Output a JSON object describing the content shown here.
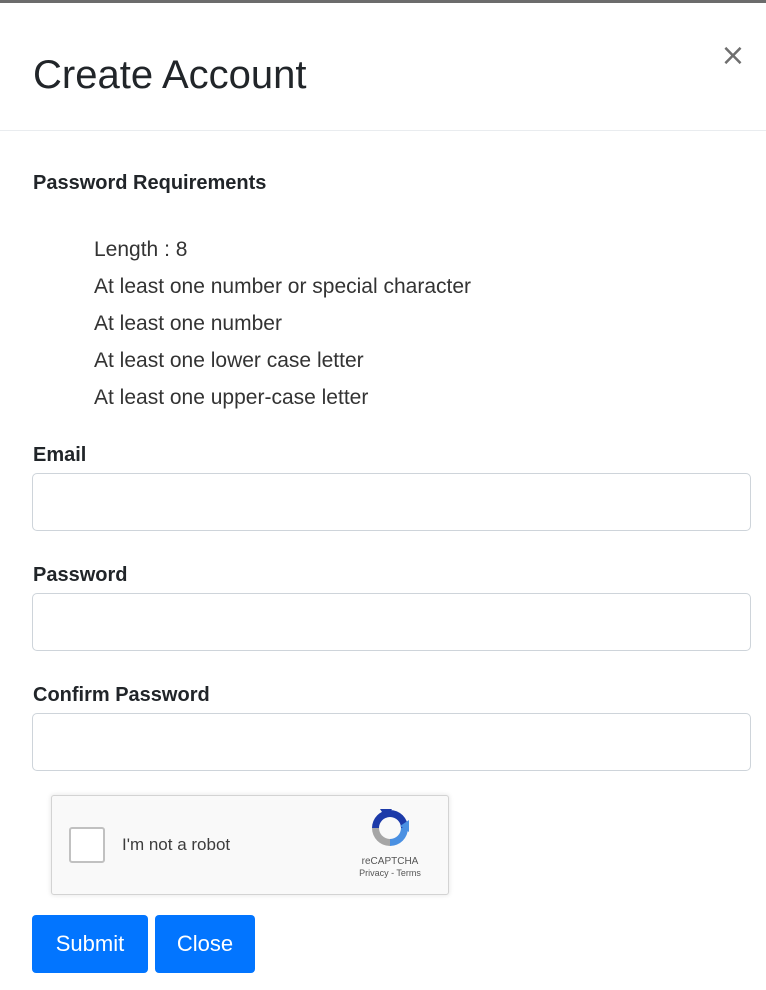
{
  "modal": {
    "title": "Create Account",
    "close_symbol": "×"
  },
  "requirements": {
    "heading": "Password Requirements",
    "items": [
      "Length : 8",
      "At least one number or special character",
      "At least one number",
      "At least one lower case letter",
      "At least one upper-case letter"
    ]
  },
  "form": {
    "email_label": "Email",
    "email_value": "",
    "password_label": "Password",
    "password_value": "",
    "confirm_label": "Confirm Password",
    "confirm_value": ""
  },
  "recaptcha": {
    "label": "I'm not a robot",
    "brand": "reCAPTCHA",
    "links": "Privacy - Terms",
    "checked": false
  },
  "buttons": {
    "submit": "Submit",
    "close": "Close"
  },
  "colors": {
    "primary": "#0275ff",
    "text": "#212529",
    "border": "#ced4da"
  }
}
